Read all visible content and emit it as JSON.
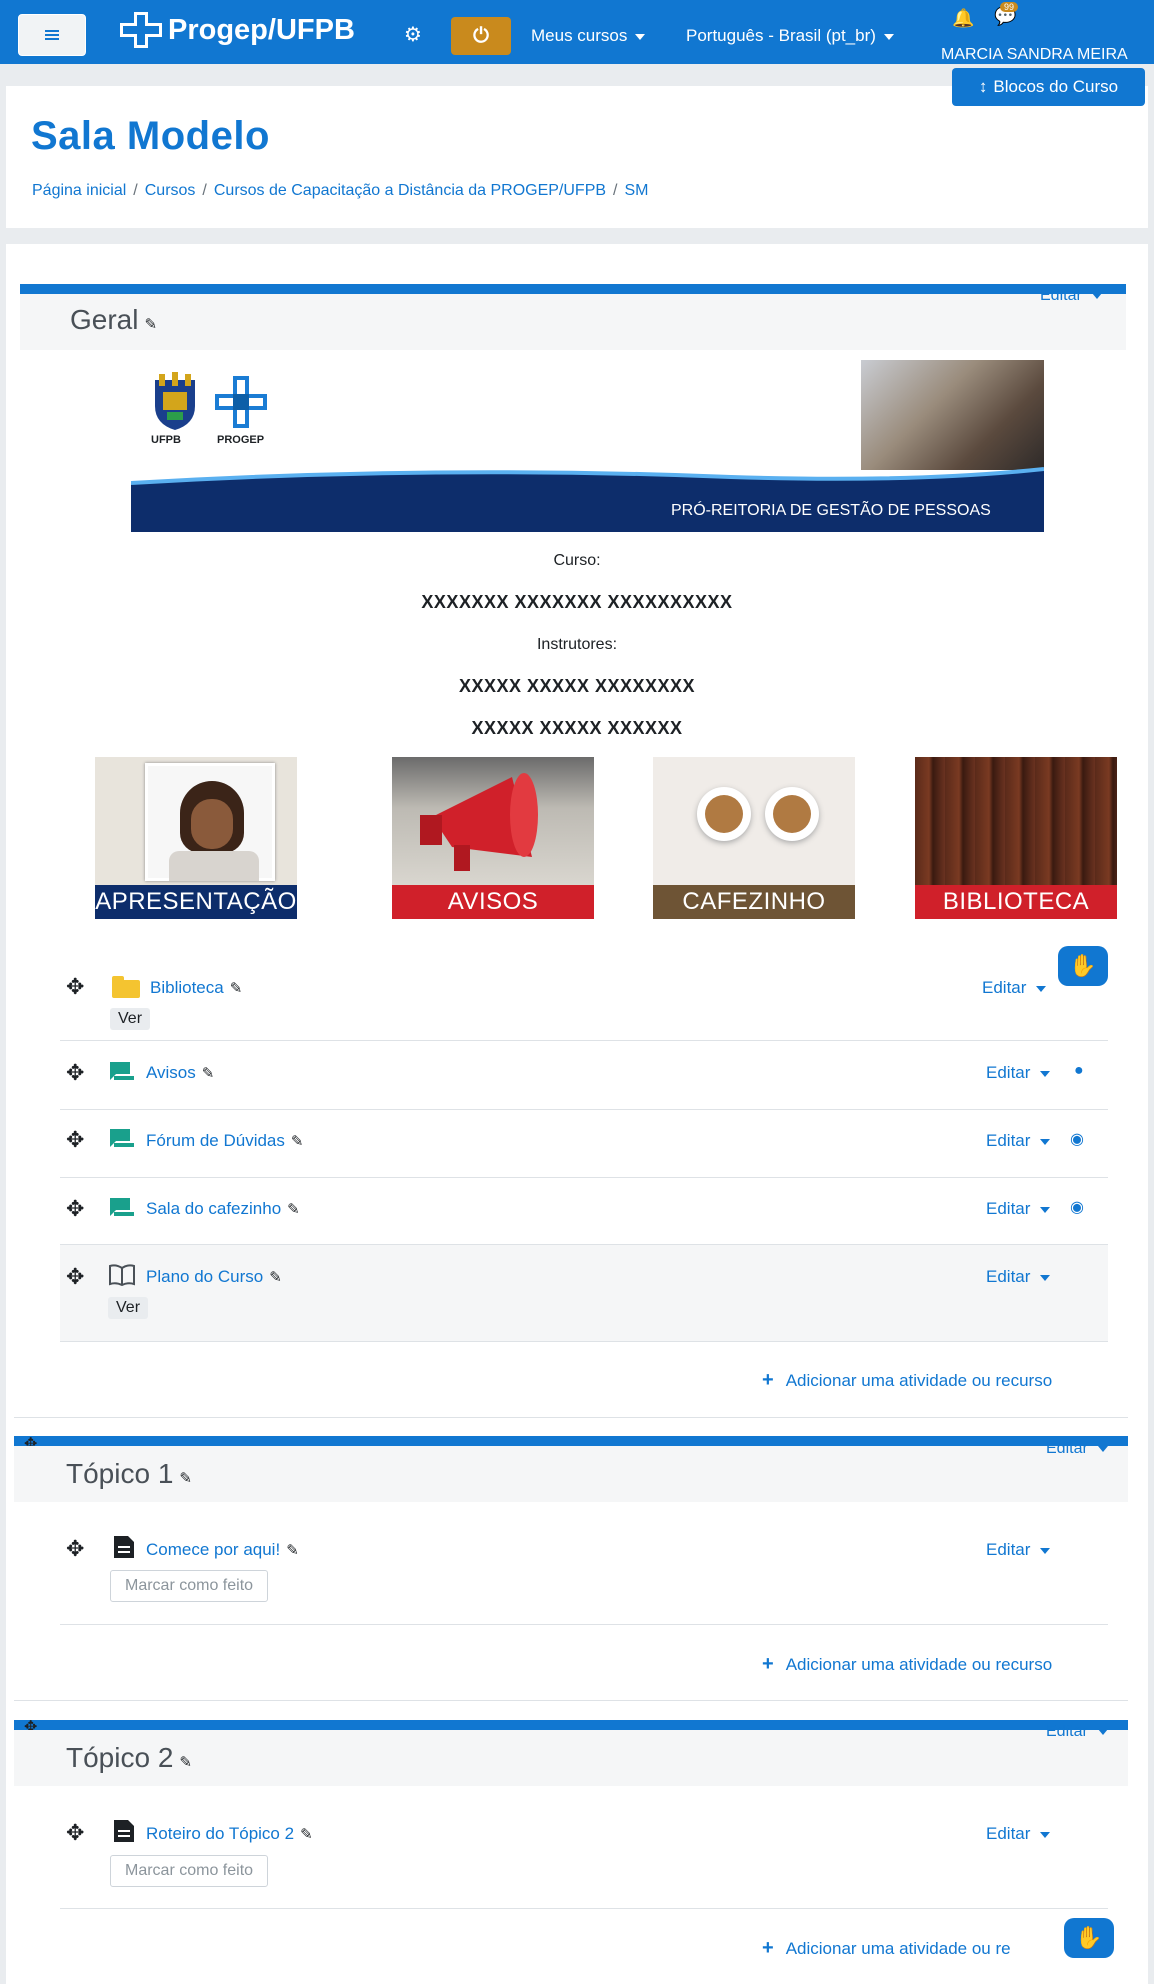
{
  "navbar": {
    "brand": "Progep/UFPB",
    "my_courses": "Meus cursos",
    "language": "Português - Brasil (pt_br)",
    "chat_badge": "99",
    "user_name": "MARCIA SANDRA MEIRA"
  },
  "blocks_button": "Blocos do Curso",
  "header": {
    "title": "Sala Modelo",
    "breadcrumb": [
      "Página inicial",
      "Cursos",
      "Cursos de Capacitação a Distância da PROGEP/UFPB",
      "SM"
    ]
  },
  "geral": {
    "title": "Geral",
    "edit": "Editar",
    "banner": {
      "ufpb_label": "UFPB",
      "progep_label": "PROGEP",
      "caption": "PRÓ-REITORIA DE GESTÃO DE PESSOAS"
    },
    "course_label": "Curso:",
    "course_name": "XXXXXXX XXXXXXX XXXXXXXXXX",
    "instructors_label": "Instrutores:",
    "instructor_1": "XXXXX XXXXX XXXXXXXX",
    "instructor_2": "XXXXX XXXXX XXXXXX",
    "tiles": [
      {
        "label": "APRESENTAÇÃO",
        "color": "#0d2d6b"
      },
      {
        "label": "AVISOS",
        "color": "#d0202a"
      },
      {
        "label": "CAFEZINHO",
        "color": "#6e5435"
      },
      {
        "label": "BIBLIOTECA",
        "color": "#d0202a"
      }
    ],
    "activities": [
      {
        "name": "Biblioteca",
        "edit": "Editar",
        "badge": "Ver"
      },
      {
        "name": "Avisos",
        "edit": "Editar"
      },
      {
        "name": "Fórum de Dúvidas",
        "edit": "Editar"
      },
      {
        "name": "Sala do cafezinho",
        "edit": "Editar"
      },
      {
        "name": "Plano do Curso",
        "edit": "Editar",
        "badge": "Ver"
      }
    ],
    "add_activity": "Adicionar uma atividade ou recurso"
  },
  "topic1": {
    "title": "Tópico 1",
    "edit": "Editar",
    "activity": {
      "name": "Comece por aqui!",
      "edit": "Editar",
      "button": "Marcar como feito"
    },
    "add_activity": "Adicionar uma atividade ou recurso"
  },
  "topic2": {
    "title": "Tópico 2",
    "edit": "Editar",
    "activity": {
      "name": "Roteiro do Tópico 2",
      "edit": "Editar",
      "button": "Marcar como feito"
    },
    "add_activity": "Adicionar uma atividade ou re"
  },
  "colors": {
    "primary": "#1177d1",
    "accent": "#c98a1d",
    "forum_icon": "#19a08c",
    "folder_icon": "#f4c430"
  }
}
